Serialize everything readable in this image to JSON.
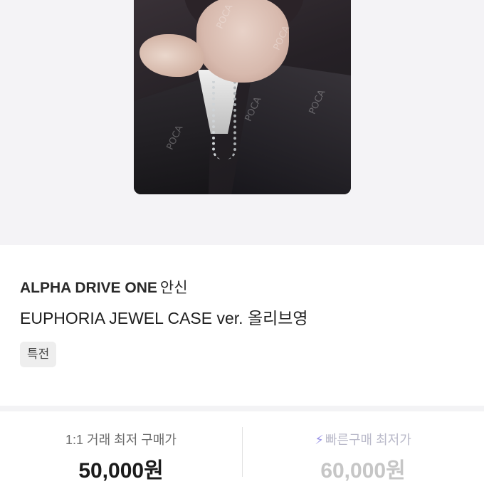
{
  "product": {
    "artist": "ALPHA DRIVE ONE",
    "artist_badge": "안신",
    "title": "EUPHORIA JEWEL CASE ver. 올리브영",
    "tag": "특전",
    "watermark": "POCA 포카마켓"
  },
  "prices": {
    "direct_label": "1:1 거래 최저 구매가",
    "direct_value": "50,000원",
    "fast_icon": "lightning-icon",
    "fast_label": "빠른구매 최저가",
    "fast_value": "60,000원"
  },
  "colors": {
    "accent": "#9b95e8",
    "hero_bg": "#f4f3f6"
  }
}
